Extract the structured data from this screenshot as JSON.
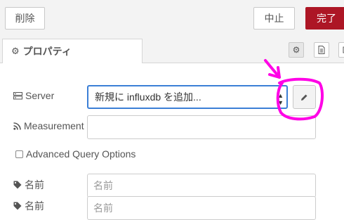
{
  "toolbar": {
    "delete_label": "削除",
    "cancel_label": "中止",
    "done_label": "完了"
  },
  "tabs": {
    "properties_label": "プロパティ"
  },
  "form": {
    "server": {
      "label": "Server",
      "selected_value": "新規に influxdb を追加..."
    },
    "measurement": {
      "label": "Measurement",
      "value": ""
    },
    "advanced_query": {
      "label": "Advanced Query Options",
      "checked": false
    },
    "name": {
      "label": "名前",
      "placeholder": "名前"
    },
    "name2": {
      "label": "名前",
      "placeholder": "名前"
    }
  },
  "colors": {
    "accent_red": "#ad1625",
    "focus_blue": "#3b7fd6",
    "annotation_magenta": "#ff00e6"
  },
  "icons": [
    "gear-icon",
    "document-icon",
    "frame-icon",
    "server-icon",
    "rss-icon",
    "tag-icon",
    "pencil-icon"
  ]
}
